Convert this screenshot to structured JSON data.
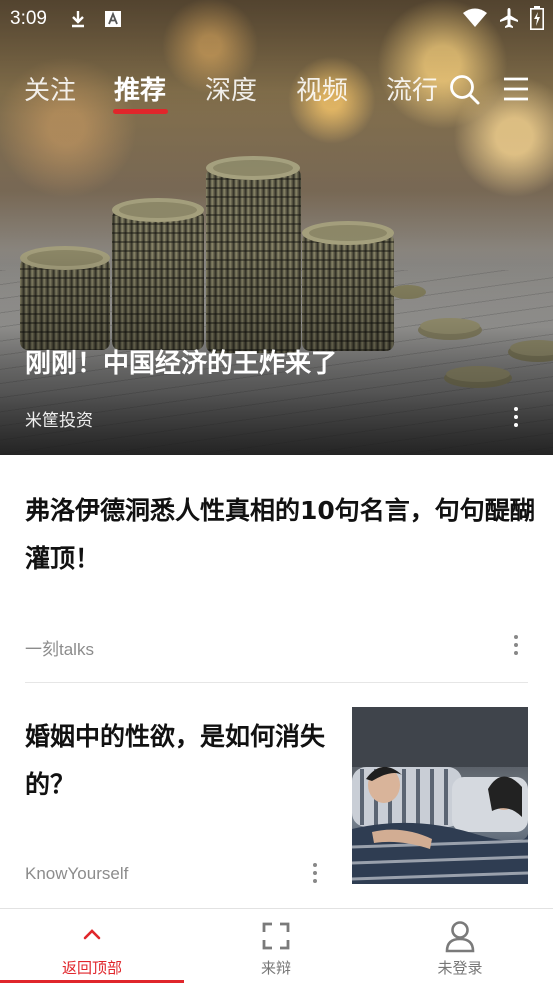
{
  "status_bar": {
    "time": "3:09",
    "icons": [
      "download-icon",
      "a-notification-icon",
      "wifi-icon",
      "airplane-mode-icon",
      "battery-charging-icon"
    ]
  },
  "top_nav": {
    "tabs": [
      "关注",
      "推荐",
      "深度",
      "视频",
      "流行"
    ],
    "active_tab": "推荐",
    "accent_color": "#e0262b",
    "right_icons": [
      "search-icon",
      "menu-icon"
    ]
  },
  "hero": {
    "title": "刚刚！中国经济的王炸来了",
    "source": "米筐投资",
    "image": "stacked-coins-photo"
  },
  "articles": [
    {
      "title": "弗洛伊德洞悉人性真相的10句名言，句句醍醐灌顶！",
      "source": "一刻talks"
    },
    {
      "title": "婚姻中的性欲，是如何消失的？",
      "source": "KnowYourself",
      "image": "couple-sleeping-photo"
    }
  ],
  "bottom_bar": {
    "items": [
      {
        "label": "返回顶部",
        "icon": "chevron-up-icon",
        "active": true
      },
      {
        "label": "来辩",
        "icon": "frame-corners-icon",
        "active": false
      },
      {
        "label": "未登录",
        "icon": "user-icon",
        "active": false
      }
    ]
  }
}
